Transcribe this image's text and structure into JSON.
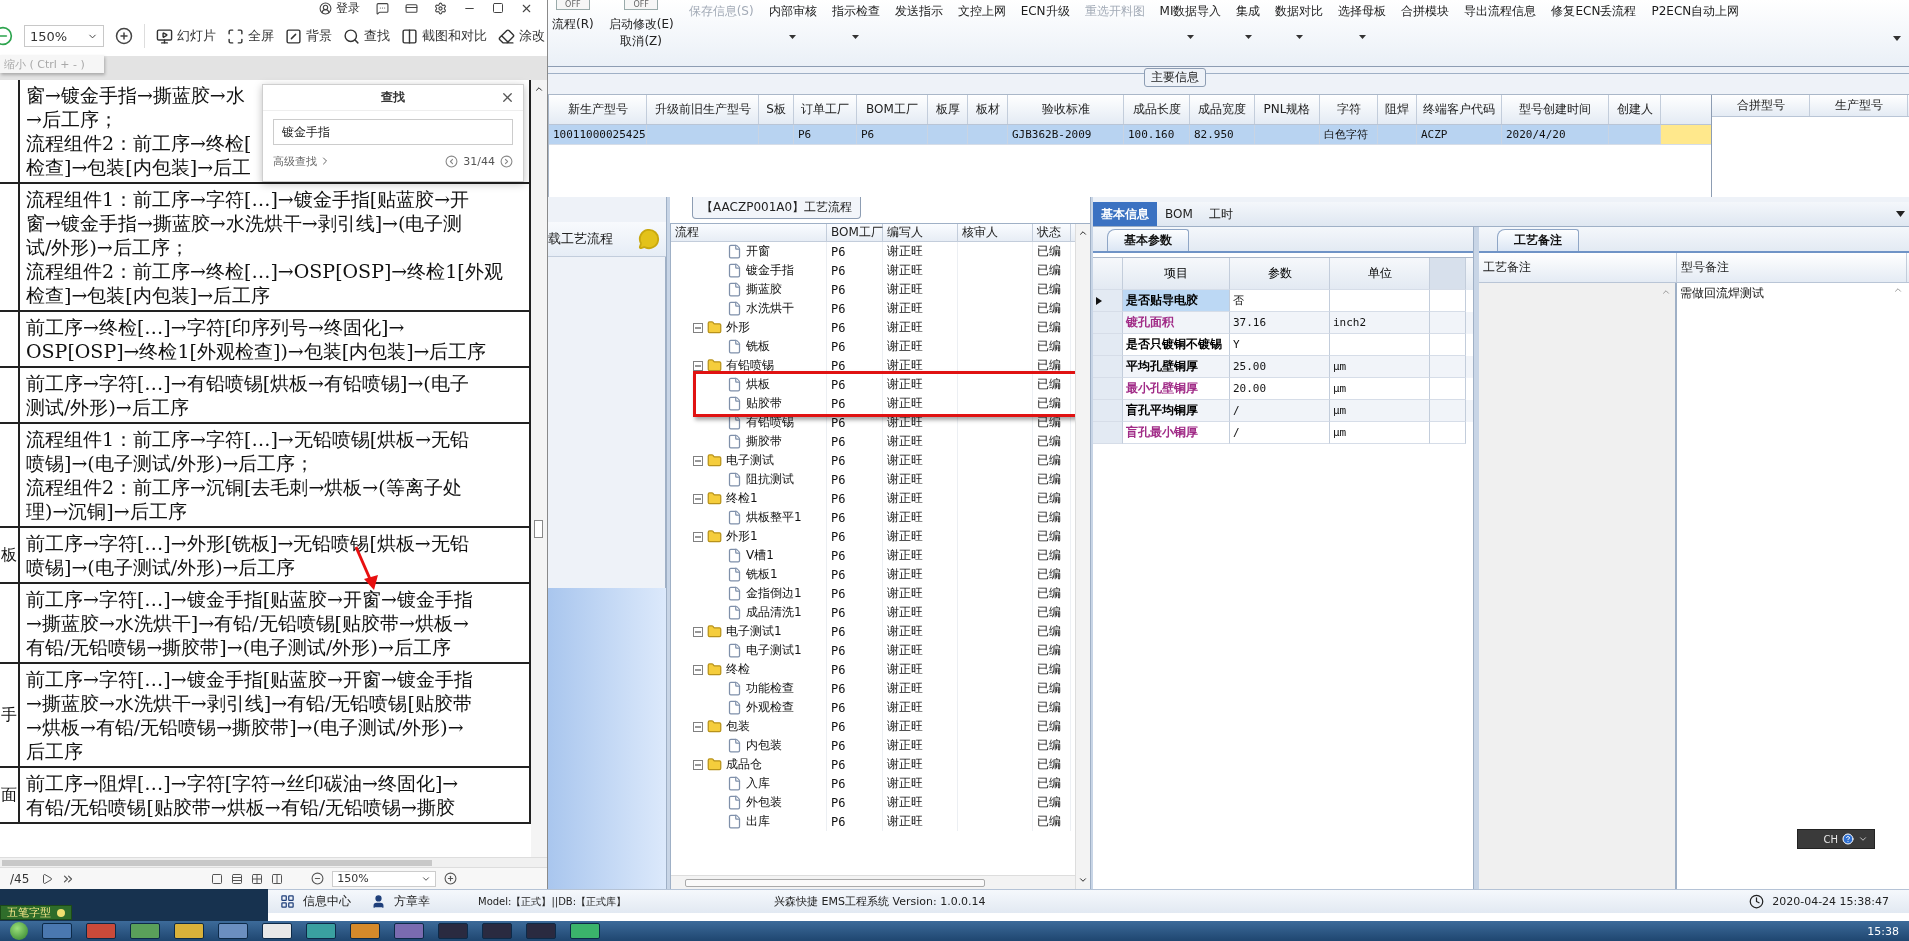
{
  "pdf_viewer": {
    "title_bar": {
      "login": "登录"
    },
    "toolbar": {
      "zoom": "150%",
      "tooltip": "缩小 ( Ctrl + - )",
      "tools": [
        {
          "kind": "slideshow",
          "label": "幻灯片"
        },
        {
          "kind": "fullscreen",
          "label": "全屏"
        },
        {
          "kind": "background",
          "label": "背景"
        },
        {
          "kind": "find",
          "label": "查找"
        },
        {
          "kind": "compare",
          "label": "截图和对比"
        },
        {
          "kind": "edit",
          "label": "涂改"
        }
      ]
    },
    "rows": [
      {
        "lines": [
          "窗→镀金手指→撕蓝胶→水",
          "→后工序；",
          "流程组件2：前工序→终检[",
          "检查]→包装[内包装]→后工"
        ]
      },
      {
        "lines": [
          "流程组件1：前工序→字符[…]→镀金手指[贴蓝胶→开",
          "窗→镀金手指→撕蓝胶→水洗烘干→剥引线]→(电子测",
          "试/外形)→后工序；",
          "流程组件2：前工序→终检[…]→OSP[OSP]→终检1[外观",
          "检查]→包装[内包装]→后工序"
        ]
      },
      {
        "lines": [
          "前工序→终检[…]→字符[印序列号→终固化]→",
          "OSP[OSP]→终检1[外观检查])→包装[内包装]→后工序"
        ]
      },
      {
        "lines": [
          "前工序→字符[…]→有铅喷锡[烘板→有铅喷锡]→(电子",
          "测试/外形)→后工序"
        ]
      },
      {
        "lines": [
          "流程组件1：前工序→字符[…]→无铅喷锡[烘板→无铅",
          "喷锡]→(电子测试/外形)→后工序；",
          "流程组件2：前工序→沉铜[去毛刺→烘板→(等离子处",
          "理)→沉铜]→后工序"
        ]
      },
      {
        "side": "板",
        "lines": [
          "前工序→字符[…]→外形[铣板]→无铅喷锡[烘板→无铅",
          "喷锡]→(电子测试/外形)→后工序"
        ]
      },
      {
        "lines": [
          "前工序→字符[…]→镀金手指[贴蓝胶→开窗→镀金手指",
          "→撕蓝胶→水洗烘干]→有铅/无铅喷锡[贴胶带→烘板→",
          "有铅/无铅喷锡→撕胶带]→(电子测试/外形)→后工序"
        ]
      },
      {
        "side": "手",
        "lines": [
          "前工序→字符[…]→镀金手指[贴蓝胶→开窗→镀金手指",
          "→撕蓝胶→水洗烘干→剥引线]→有铅/无铅喷锡[贴胶带",
          "→烘板→有铅/无铅喷锡→撕胶带]→(电子测试/外形)→",
          "后工序"
        ]
      },
      {
        "side": "面",
        "lines": [
          "前工序→阻焊[…]→字符[字符→丝印碳油→终固化]→",
          "有铅/无铅喷锡[贴胶带→烘板→有铅/无铅喷锡→撕胶"
        ]
      }
    ],
    "find_dialog": {
      "title": "查找",
      "value": "镀金手指",
      "advanced": "高级查找",
      "counter": "31/44"
    },
    "footer": {
      "pages": "/45",
      "zoom": "150%"
    }
  },
  "toolbar": {
    "stacks": [
      {
        "switch": "OFF",
        "on": false,
        "labels": [
          "流程(R)"
        ]
      },
      {
        "switch": "OFF",
        "on": false,
        "labels": [
          "启动修改(E)",
          "取消(Z)"
        ]
      }
    ],
    "buttons": [
      {
        "label": "保存信息(S)",
        "disabled": true,
        "menu": false
      },
      {
        "label": "内部审核",
        "disabled": false,
        "menu": true
      },
      {
        "label": "指示检查",
        "disabled": false,
        "menu": true
      },
      {
        "label": "发送指示",
        "disabled": false,
        "menu": false
      },
      {
        "label": "文控上网",
        "disabled": false,
        "menu": false
      },
      {
        "label": "ECN升级",
        "disabled": false,
        "menu": false
      },
      {
        "label": "重选开料图",
        "disabled": true,
        "menu": false
      },
      {
        "label": "MI数据导入",
        "disabled": false,
        "menu": true
      },
      {
        "label": "集成",
        "disabled": false,
        "menu": true
      },
      {
        "label": "数据对比",
        "disabled": false,
        "menu": true
      },
      {
        "label": "选择母板",
        "disabled": false,
        "menu": true
      },
      {
        "label": "合拼模块",
        "disabled": false,
        "menu": false
      },
      {
        "label": "导出流程信息",
        "disabled": false,
        "menu": false
      },
      {
        "label": "修复ECN丢流程",
        "disabled": false,
        "menu": false
      },
      {
        "label": "P2ECN自动上网",
        "disabled": false,
        "menu": false
      }
    ]
  },
  "main_info": {
    "caption": "主要信息",
    "columns": [
      "新生产型号",
      "升级前旧生产型号",
      "S板",
      "订单工厂",
      "BOM工厂",
      "板厚",
      "板材",
      "验收标准",
      "成品长度",
      "成品宽度",
      "PNL规格",
      "字符",
      "阻焊",
      "终端客户代码",
      "型号创建时间",
      "创建人"
    ],
    "rows": [
      {
        "selected": true,
        "cells": [
          "10011000025425",
          null,
          null,
          "P6",
          "P6",
          null,
          null,
          "GJB362B-2009",
          "100.160",
          "82.950",
          null,
          "白色字符",
          null,
          "ACZP",
          "2020/4/20",
          null
        ]
      }
    ],
    "side_columns": [
      "合拼型号",
      "生产型号"
    ]
  },
  "process": {
    "sidebar_title": "载工艺流程",
    "caption": "【AACZP001A0】工艺流程",
    "columns": [
      "流程",
      "BOM工厂",
      "编写人",
      "核审人",
      "状态"
    ],
    "nodes": [
      {
        "children": [
          {
            "label": "开窗",
            "bom": "P6",
            "author": "谢正旺",
            "status": "已编"
          },
          {
            "label": "镀金手指",
            "bom": "P6",
            "author": "谢正旺",
            "status": "已编"
          },
          {
            "label": "撕蓝胶",
            "bom": "P6",
            "author": "谢正旺",
            "status": "已编"
          },
          {
            "label": "水洗烘干",
            "bom": "P6",
            "author": "谢正旺",
            "status": "已编"
          }
        ]
      },
      {
        "label": "外形",
        "bom": "P6",
        "author": "谢正旺",
        "status": "已编",
        "expanded": true,
        "children": [
          {
            "label": "铣板",
            "bom": "P6",
            "author": "谢正旺",
            "status": "已编"
          }
        ]
      },
      {
        "label": "有铅喷锡",
        "bom": "P6",
        "author": "谢正旺",
        "status": "已编",
        "expanded": true,
        "children": [
          {
            "label": "烘板",
            "bom": "P6",
            "author": "谢正旺",
            "status": "已编"
          },
          {
            "label": "贴胶带",
            "bom": "P6",
            "author": "谢正旺",
            "status": "已编"
          },
          {
            "label": "有铅喷锡",
            "bom": "P6",
            "author": "谢正旺",
            "status": "已编"
          },
          {
            "label": "撕胶带",
            "bom": "P6",
            "author": "谢正旺",
            "status": "已编"
          }
        ]
      },
      {
        "label": "电子测试",
        "bom": "P6",
        "author": "谢正旺",
        "status": "已编",
        "expanded": true,
        "children": [
          {
            "label": "阻抗测试",
            "bom": "P6",
            "author": "谢正旺",
            "status": "已编"
          }
        ]
      },
      {
        "label": "终检1",
        "bom": "P6",
        "author": "谢正旺",
        "status": "已编",
        "expanded": true,
        "children": [
          {
            "label": "烘板整平1",
            "bom": "P6",
            "author": "谢正旺",
            "status": "已编"
          }
        ]
      },
      {
        "label": "外形1",
        "bom": "P6",
        "author": "谢正旺",
        "status": "已编",
        "expanded": true,
        "children": [
          {
            "label": "V槽1",
            "bom": "P6",
            "author": "谢正旺",
            "status": "已编"
          },
          {
            "label": "铣板1",
            "bom": "P6",
            "author": "谢正旺",
            "status": "已编"
          },
          {
            "label": "金指倒边1",
            "bom": "P6",
            "author": "谢正旺",
            "status": "已编"
          },
          {
            "label": "成品清洗1",
            "bom": "P6",
            "author": "谢正旺",
            "status": "已编"
          }
        ]
      },
      {
        "label": "电子测试1",
        "bom": "P6",
        "author": "谢正旺",
        "status": "已编",
        "expanded": true,
        "children": [
          {
            "label": "电子测试1",
            "bom": "P6",
            "author": "谢正旺",
            "status": "已编"
          }
        ]
      },
      {
        "label": "终检",
        "bom": "P6",
        "author": "谢正旺",
        "status": "已编",
        "expanded": true,
        "children": [
          {
            "label": "功能检查",
            "bom": "P6",
            "author": "谢正旺",
            "status": "已编"
          },
          {
            "label": "外观检查",
            "bom": "P6",
            "author": "谢正旺",
            "status": "已编"
          }
        ]
      },
      {
        "label": "包装",
        "bom": "P6",
        "author": "谢正旺",
        "status": "已编",
        "expanded": true,
        "children": [
          {
            "label": "内包装",
            "bom": "P6",
            "author": "谢正旺",
            "status": "已编"
          }
        ]
      },
      {
        "label": "成品仓",
        "bom": "P6",
        "author": "谢正旺",
        "status": "已编",
        "expanded": true,
        "children": [
          {
            "label": "入库",
            "bom": "P6",
            "author": "谢正旺",
            "status": "已编"
          },
          {
            "label": "外包装",
            "bom": "P6",
            "author": "谢正旺",
            "status": "已编"
          },
          {
            "label": "出库",
            "bom": "P6",
            "author": "谢正旺",
            "status": "已编"
          }
        ]
      }
    ]
  },
  "details": {
    "tabs": [
      {
        "label": "基本信息",
        "selected": true
      },
      {
        "label": "BOM",
        "selected": false
      },
      {
        "label": "工时",
        "selected": false
      }
    ],
    "params": {
      "tab": "基本参数",
      "columns": [
        "项目",
        "参数",
        "单位"
      ],
      "rows": [
        {
          "item": "是否贴导电胶",
          "value": "否",
          "color": "#000000",
          "selected": true
        },
        {
          "item": "镀孔面积",
          "value": "37.16",
          "unit": "inch2",
          "color": "#a02a86",
          "selected": false
        },
        {
          "item": "是否只镀铜不镀锡",
          "value": "Y",
          "color": "#000000",
          "selected": false
        },
        {
          "item": "平均孔壁铜厚",
          "value": "25.00",
          "unit": "μm",
          "color": "#000000",
          "selected": false
        },
        {
          "item": "最小孔壁铜厚",
          "value": "20.00",
          "unit": "μm",
          "color": "#a02a86",
          "selected": false
        },
        {
          "item": "盲孔平均铜厚",
          "value": "/",
          "unit": "μm",
          "color": "#000000",
          "selected": false
        },
        {
          "item": "盲孔最小铜厚",
          "value": "/",
          "unit": "μm",
          "color": "#a02a86",
          "selected": false
        }
      ]
    },
    "notes": {
      "tab": "工艺备注",
      "columns": [
        "工艺备注",
        "型号备注"
      ],
      "model_note": "需做回流焊测试"
    },
    "language_bar": "CH"
  },
  "status_bar": {
    "info_center": "信息中心",
    "user": "方章幸",
    "model": "Model:【正式】||DB:【正式库】",
    "system": "兴森快捷 EMS工程系统 Version: 1.0.0.14",
    "datetime": "2020-04-24 15:38:47"
  },
  "ime": "五笔字型",
  "taskbar": {
    "clock": "15:38"
  }
}
